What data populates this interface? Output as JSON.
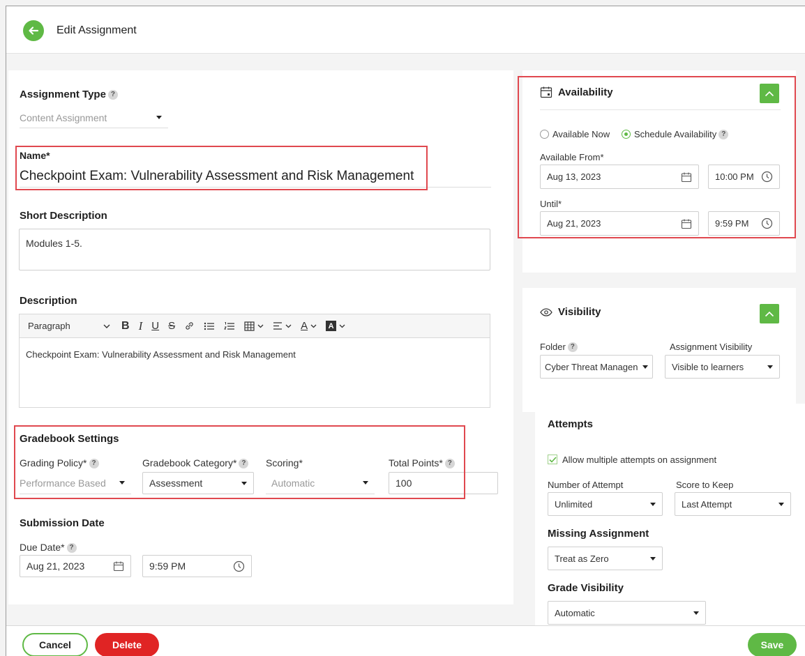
{
  "header": {
    "title": "Edit Assignment"
  },
  "assignment_type": {
    "label": "Assignment Type",
    "help": "?",
    "value": "Content Assignment"
  },
  "name": {
    "label": "Name*",
    "value": "Checkpoint Exam: Vulnerability Assessment and Risk Management"
  },
  "short_description": {
    "label": "Short Description",
    "value": "Modules 1-5."
  },
  "description": {
    "label": "Description",
    "toolbar": {
      "paragraph": "Paragraph",
      "bold": "B",
      "italic": "I",
      "underline": "U",
      "strike": "S",
      "font_color": "A"
    },
    "content": "Checkpoint Exam: Vulnerability Assessment and Risk Management"
  },
  "gradebook": {
    "title": "Gradebook Settings",
    "grading_policy": {
      "label": "Grading Policy*",
      "value": "Performance Based"
    },
    "category": {
      "label": "Gradebook Category*",
      "value": "Assessment"
    },
    "scoring": {
      "label": "Scoring*",
      "value": "Automatic"
    },
    "total_points": {
      "label": "Total Points*",
      "value": "100"
    }
  },
  "submission": {
    "title": "Submission Date",
    "due_label": "Due Date*",
    "due_date": "Aug 21, 2023",
    "due_time": "9:59 PM"
  },
  "availability": {
    "title": "Availability",
    "option_now": "Available Now",
    "option_schedule": "Schedule Availability",
    "selected": "schedule",
    "from_label": "Available From*",
    "from_date": "Aug 13, 2023",
    "from_time": "10:00 PM",
    "until_label": "Until*",
    "until_date": "Aug 21, 2023",
    "until_time": "9:59 PM"
  },
  "visibility": {
    "title": "Visibility",
    "folder_label": "Folder",
    "folder_value": "Cyber Threat Managen",
    "assignment_visibility_label": "Assignment Visibility",
    "assignment_visibility_value": "Visible to learners"
  },
  "attempts": {
    "title": "Attempts",
    "allow_multiple": "Allow multiple attempts on assignment",
    "allow_multiple_checked": true,
    "number_label": "Number of Attempt",
    "number_value": "Unlimited",
    "keep_label": "Score to Keep",
    "keep_value": "Last Attempt"
  },
  "missing": {
    "title": "Missing Assignment",
    "value": "Treat as Zero"
  },
  "grade_visibility": {
    "title": "Grade Visibility",
    "value": "Automatic"
  },
  "footer": {
    "cancel": "Cancel",
    "delete": "Delete",
    "save": "Save"
  },
  "colors": {
    "accent_green": "#5fb945",
    "danger_red": "#e02424",
    "highlight_red": "#e0484f"
  }
}
